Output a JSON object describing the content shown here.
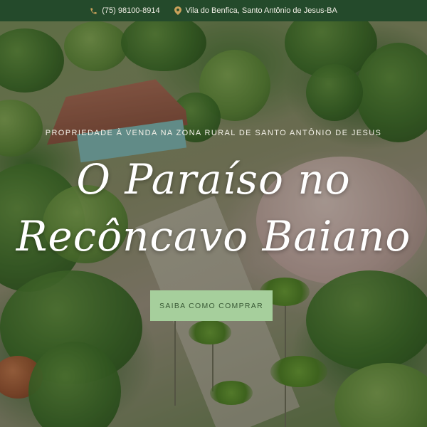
{
  "topbar": {
    "phone": "(75) 98100-8914",
    "phone_icon": "phone-icon",
    "address": "Vila do Benfica, Santo Antônio de Jesus-BA",
    "address_icon": "map-pin-icon"
  },
  "hero": {
    "eyebrow": "PROPRIEDADE À VENDA NA ZONA RURAL DE SANTO ANTÔNIO DE JESUS",
    "headline_line1": "O Paraíso no",
    "headline_line2": "Recôncavo Baiano",
    "cta_label": "SAIBA COMO COMPRAR"
  },
  "colors": {
    "topbar_bg": "#244a2b",
    "cta_bg": "#a6cf9c",
    "cta_text": "#3a5a36",
    "icon_accent": "#c9a15a"
  }
}
